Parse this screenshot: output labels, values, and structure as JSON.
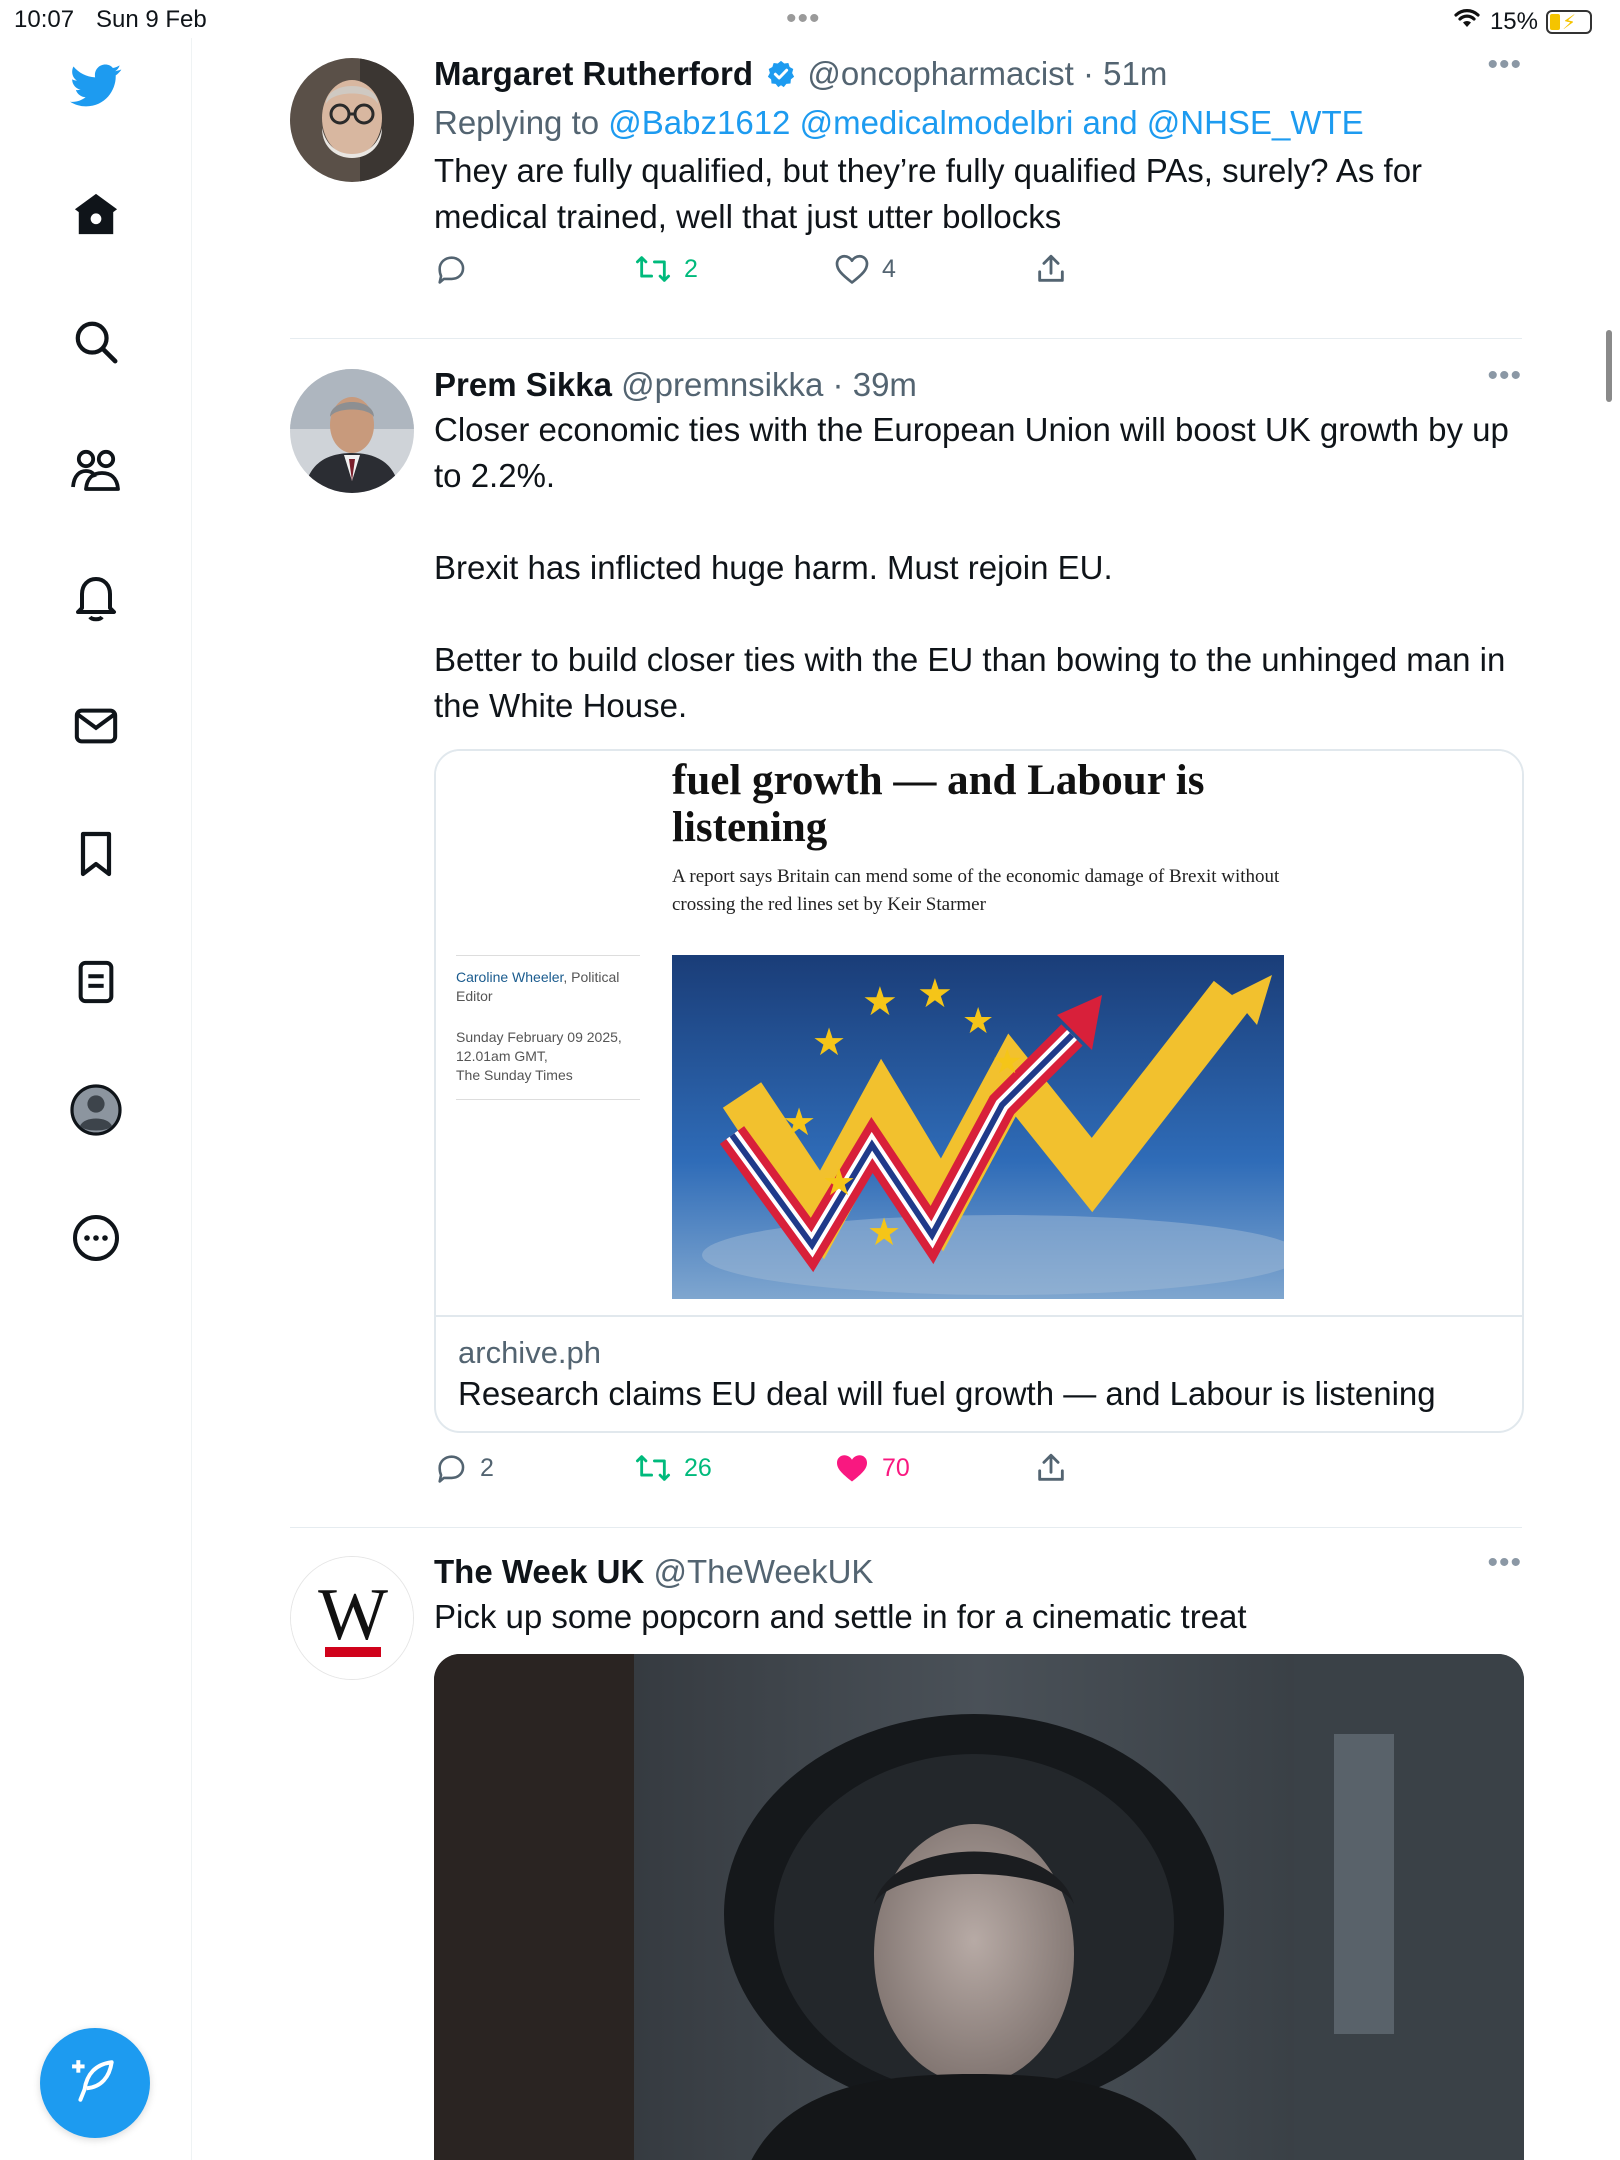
{
  "status_bar": {
    "time": "10:07",
    "date": "Sun 9 Feb",
    "battery": "15%"
  },
  "colors": {
    "accent": "#1d9bf0",
    "retweet": "#00ba7c",
    "like": "#f91880",
    "secondary_text": "#536471"
  },
  "sidebar": {
    "items": [
      {
        "name": "twitter-logo-icon"
      },
      {
        "name": "home-icon"
      },
      {
        "name": "search-icon"
      },
      {
        "name": "communities-icon"
      },
      {
        "name": "notifications-icon"
      },
      {
        "name": "messages-icon"
      },
      {
        "name": "bookmarks-icon"
      },
      {
        "name": "lists-icon"
      },
      {
        "name": "profile-icon"
      },
      {
        "name": "more-icon"
      }
    ],
    "compose": "compose-tweet-icon"
  },
  "tweets": [
    {
      "name": "Margaret Rutherford",
      "handle": "@oncopharmacist",
      "sep": "·",
      "time": "51m",
      "verified": true,
      "reply_prefix": "Replying to",
      "reply_to_1": "@Babz1612",
      "reply_to_2": "@medicalmodelbri",
      "reply_and": "and",
      "reply_to_3": "@NHSE_WTE",
      "text": "They are fully qualified, but they’re fully qualified PAs, surely? As for medical trained, well that just utter bollocks",
      "replies": "",
      "retweets": "2",
      "likes": "4"
    },
    {
      "name": "Prem Sikka",
      "handle": "@premnsikka",
      "sep": "·",
      "time": "39m",
      "text": "Closer economic ties with the European Union will boost UK growth by up to 2.2%.\n\nBrexit has inflicted huge harm. Must rejoin EU.\n\nBetter to build closer ties with the EU than bowing to the unhinged man in the White House.",
      "card": {
        "headline": "fuel growth — and Labour is listening",
        "subhead": "A report says Britain can mend some of the economic damage of Brexit without crossing the red lines set by Keir Starmer",
        "byline_author": "Caroline Wheeler",
        "byline_role": ", Political Editor",
        "byline_meta": "Sunday February 09 2025,\n12.01am GMT,\nThe Sunday Times",
        "domain": "archive.ph",
        "title": "Research claims EU deal will fuel growth — and Labour is listening"
      },
      "replies": "2",
      "retweets": "26",
      "likes": "70",
      "liked": true
    },
    {
      "name": "The Week UK",
      "handle": "@TheWeekUK",
      "text": "Pick up some popcorn and settle in for a cinematic treat",
      "avatar_letter": "W"
    }
  ]
}
